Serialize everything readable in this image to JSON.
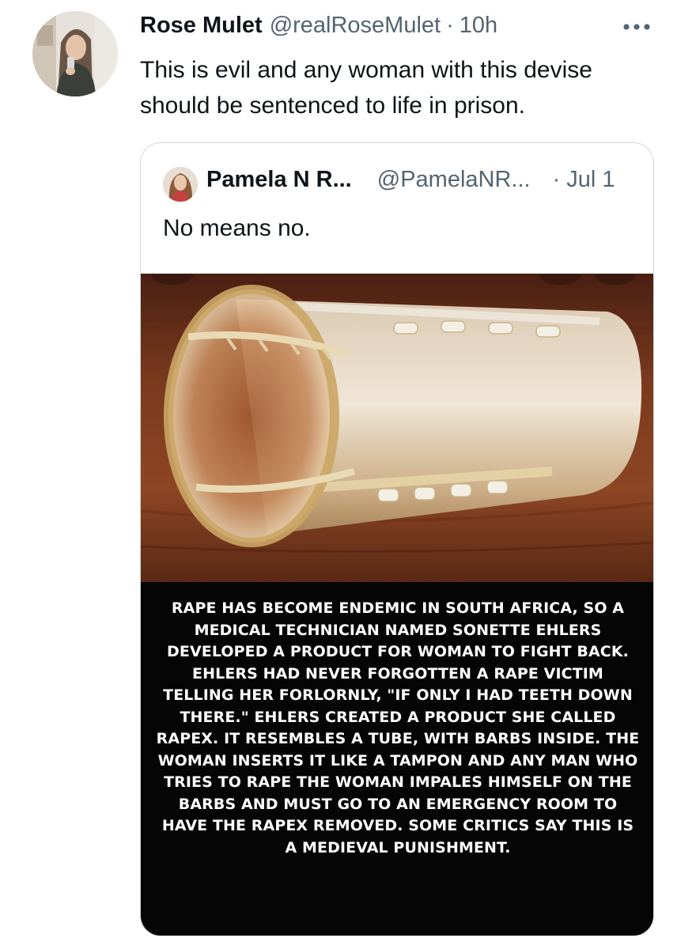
{
  "tweet": {
    "display_name": "Rose Mulet",
    "handle": "@realRoseMulet",
    "separator": "·",
    "time": "10h",
    "text": "This is evil and any woman with this devise should be sentenced to life in prison.",
    "more_icon": "ellipsis-icon"
  },
  "quote": {
    "display_name": "Pamela N R...",
    "handle": "@PamelaNR...",
    "separator": "·",
    "time": "Jul 1",
    "text": "No means no.",
    "media": {
      "caption": "RAPE HAS BECOME ENDEMIC IN SOUTH AFRICA, SO A MEDICAL TECHNICIAN NAMED SONETTE EHLERS DEVELOPED A PRODUCT FOR WOMAN TO FIGHT BACK. EHLERS HAD NEVER FORGOTTEN A RAPE VICTIM TELLING HER FORLORNLY, \"IF ONLY I HAD TEETH DOWN THERE.\" EHLERS CREATED A PRODUCT SHE CALLED RAPEX. IT RESEMBLES A TUBE, WITH BARBS INSIDE. THE WOMAN INSERTS IT LIKE A TAMPON AND ANY MAN WHO TRIES TO RAPE THE WOMAN IMPALES HIMSELF ON THE BARBS AND MUST GO TO AN EMERGENCY ROOM TO HAVE THE RAPEX REMOVED. SOME CRITICS SAY THIS IS A MEDIEVAL PUNISHMENT."
    }
  },
  "colors": {
    "text_primary": "#0f1419",
    "text_secondary": "#536471",
    "border": "#cfd9de",
    "caption_bg": "#050505"
  }
}
